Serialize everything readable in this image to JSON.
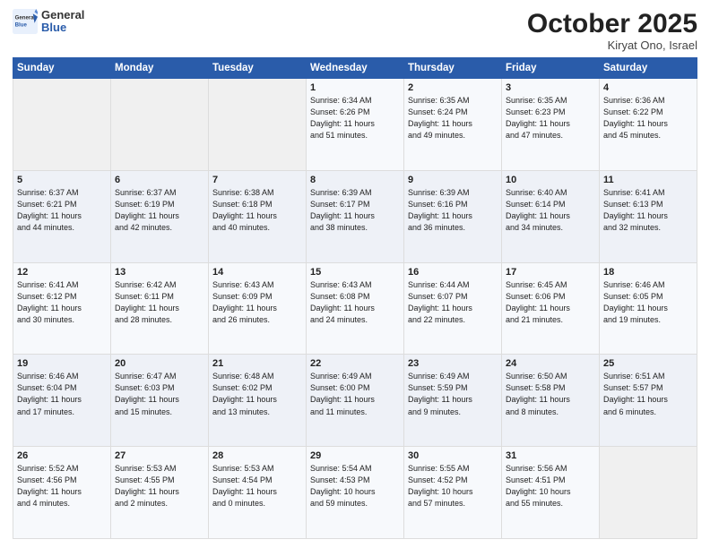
{
  "header": {
    "logo_general": "General",
    "logo_blue": "Blue",
    "month": "October 2025",
    "location": "Kiryat Ono, Israel"
  },
  "weekdays": [
    "Sunday",
    "Monday",
    "Tuesday",
    "Wednesday",
    "Thursday",
    "Friday",
    "Saturday"
  ],
  "weeks": [
    [
      {
        "day": "",
        "info": ""
      },
      {
        "day": "",
        "info": ""
      },
      {
        "day": "",
        "info": ""
      },
      {
        "day": "1",
        "info": "Sunrise: 6:34 AM\nSunset: 6:26 PM\nDaylight: 11 hours\nand 51 minutes."
      },
      {
        "day": "2",
        "info": "Sunrise: 6:35 AM\nSunset: 6:24 PM\nDaylight: 11 hours\nand 49 minutes."
      },
      {
        "day": "3",
        "info": "Sunrise: 6:35 AM\nSunset: 6:23 PM\nDaylight: 11 hours\nand 47 minutes."
      },
      {
        "day": "4",
        "info": "Sunrise: 6:36 AM\nSunset: 6:22 PM\nDaylight: 11 hours\nand 45 minutes."
      }
    ],
    [
      {
        "day": "5",
        "info": "Sunrise: 6:37 AM\nSunset: 6:21 PM\nDaylight: 11 hours\nand 44 minutes."
      },
      {
        "day": "6",
        "info": "Sunrise: 6:37 AM\nSunset: 6:19 PM\nDaylight: 11 hours\nand 42 minutes."
      },
      {
        "day": "7",
        "info": "Sunrise: 6:38 AM\nSunset: 6:18 PM\nDaylight: 11 hours\nand 40 minutes."
      },
      {
        "day": "8",
        "info": "Sunrise: 6:39 AM\nSunset: 6:17 PM\nDaylight: 11 hours\nand 38 minutes."
      },
      {
        "day": "9",
        "info": "Sunrise: 6:39 AM\nSunset: 6:16 PM\nDaylight: 11 hours\nand 36 minutes."
      },
      {
        "day": "10",
        "info": "Sunrise: 6:40 AM\nSunset: 6:14 PM\nDaylight: 11 hours\nand 34 minutes."
      },
      {
        "day": "11",
        "info": "Sunrise: 6:41 AM\nSunset: 6:13 PM\nDaylight: 11 hours\nand 32 minutes."
      }
    ],
    [
      {
        "day": "12",
        "info": "Sunrise: 6:41 AM\nSunset: 6:12 PM\nDaylight: 11 hours\nand 30 minutes."
      },
      {
        "day": "13",
        "info": "Sunrise: 6:42 AM\nSunset: 6:11 PM\nDaylight: 11 hours\nand 28 minutes."
      },
      {
        "day": "14",
        "info": "Sunrise: 6:43 AM\nSunset: 6:09 PM\nDaylight: 11 hours\nand 26 minutes."
      },
      {
        "day": "15",
        "info": "Sunrise: 6:43 AM\nSunset: 6:08 PM\nDaylight: 11 hours\nand 24 minutes."
      },
      {
        "day": "16",
        "info": "Sunrise: 6:44 AM\nSunset: 6:07 PM\nDaylight: 11 hours\nand 22 minutes."
      },
      {
        "day": "17",
        "info": "Sunrise: 6:45 AM\nSunset: 6:06 PM\nDaylight: 11 hours\nand 21 minutes."
      },
      {
        "day": "18",
        "info": "Sunrise: 6:46 AM\nSunset: 6:05 PM\nDaylight: 11 hours\nand 19 minutes."
      }
    ],
    [
      {
        "day": "19",
        "info": "Sunrise: 6:46 AM\nSunset: 6:04 PM\nDaylight: 11 hours\nand 17 minutes."
      },
      {
        "day": "20",
        "info": "Sunrise: 6:47 AM\nSunset: 6:03 PM\nDaylight: 11 hours\nand 15 minutes."
      },
      {
        "day": "21",
        "info": "Sunrise: 6:48 AM\nSunset: 6:02 PM\nDaylight: 11 hours\nand 13 minutes."
      },
      {
        "day": "22",
        "info": "Sunrise: 6:49 AM\nSunset: 6:00 PM\nDaylight: 11 hours\nand 11 minutes."
      },
      {
        "day": "23",
        "info": "Sunrise: 6:49 AM\nSunset: 5:59 PM\nDaylight: 11 hours\nand 9 minutes."
      },
      {
        "day": "24",
        "info": "Sunrise: 6:50 AM\nSunset: 5:58 PM\nDaylight: 11 hours\nand 8 minutes."
      },
      {
        "day": "25",
        "info": "Sunrise: 6:51 AM\nSunset: 5:57 PM\nDaylight: 11 hours\nand 6 minutes."
      }
    ],
    [
      {
        "day": "26",
        "info": "Sunrise: 5:52 AM\nSunset: 4:56 PM\nDaylight: 11 hours\nand 4 minutes."
      },
      {
        "day": "27",
        "info": "Sunrise: 5:53 AM\nSunset: 4:55 PM\nDaylight: 11 hours\nand 2 minutes."
      },
      {
        "day": "28",
        "info": "Sunrise: 5:53 AM\nSunset: 4:54 PM\nDaylight: 11 hours\nand 0 minutes."
      },
      {
        "day": "29",
        "info": "Sunrise: 5:54 AM\nSunset: 4:53 PM\nDaylight: 10 hours\nand 59 minutes."
      },
      {
        "day": "30",
        "info": "Sunrise: 5:55 AM\nSunset: 4:52 PM\nDaylight: 10 hours\nand 57 minutes."
      },
      {
        "day": "31",
        "info": "Sunrise: 5:56 AM\nSunset: 4:51 PM\nDaylight: 10 hours\nand 55 minutes."
      },
      {
        "day": "",
        "info": ""
      }
    ]
  ]
}
